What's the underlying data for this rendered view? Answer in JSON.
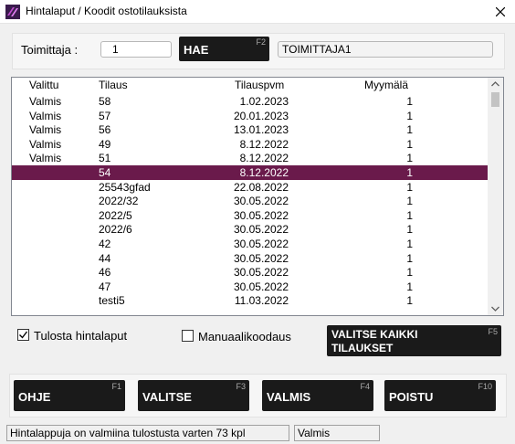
{
  "window": {
    "title": "Hintalaput / Koodit ostotilauksista",
    "icon": "app-logo-icon"
  },
  "supplier": {
    "label": "Toimittaja :",
    "value": "1",
    "search_button": "HAE",
    "search_key": "F2",
    "name": "TOIMITTAJA1"
  },
  "grid": {
    "headers": [
      "Valittu",
      "Tilaus",
      "Tilauspvm",
      "Myymälä"
    ],
    "rows": [
      {
        "status": "Valmis",
        "order": "58",
        "date": "1.02.2023",
        "store": "1"
      },
      {
        "status": "Valmis",
        "order": "57",
        "date": "20.01.2023",
        "store": "1"
      },
      {
        "status": "Valmis",
        "order": "56",
        "date": "13.01.2023",
        "store": "1"
      },
      {
        "status": "Valmis",
        "order": "49",
        "date": "8.12.2022",
        "store": "1"
      },
      {
        "status": "Valmis",
        "order": "51",
        "date": "8.12.2022",
        "store": "1"
      },
      {
        "status": "",
        "order": "54",
        "date": "8.12.2022",
        "store": "1",
        "selected": true
      },
      {
        "status": "",
        "order": "25543gfad",
        "date": "22.08.2022",
        "store": "1"
      },
      {
        "status": "",
        "order": "2022/32",
        "date": "30.05.2022",
        "store": "1"
      },
      {
        "status": "",
        "order": "2022/5",
        "date": "30.05.2022",
        "store": "1"
      },
      {
        "status": "",
        "order": "2022/6",
        "date": "30.05.2022",
        "store": "1"
      },
      {
        "status": "",
        "order": "42",
        "date": "30.05.2022",
        "store": "1"
      },
      {
        "status": "",
        "order": "44",
        "date": "30.05.2022",
        "store": "1"
      },
      {
        "status": "",
        "order": "46",
        "date": "30.05.2022",
        "store": "1"
      },
      {
        "status": "",
        "order": "47",
        "date": "30.05.2022",
        "store": "1"
      },
      {
        "status": "",
        "order": "testi5",
        "date": "11.03.2022",
        "store": "1"
      }
    ]
  },
  "options": {
    "print_labels": {
      "label": "Tulosta hintalaput",
      "checked": true
    },
    "manual_barcode": {
      "label": "Manuaalikoodaus",
      "checked": false
    },
    "select_all": {
      "label": "VALITSE KAIKKI TILAUKSET",
      "key": "F5"
    }
  },
  "buttons": [
    {
      "label": "OHJE",
      "key": "F1"
    },
    {
      "label": "VALITSE",
      "key": "F3"
    },
    {
      "label": "VALMIS",
      "key": "F4"
    },
    {
      "label": "POISTU",
      "key": "F10"
    }
  ],
  "status": {
    "message": "Hintalappuja on valmiina tulostusta varten 73  kpl",
    "state": "Valmis"
  },
  "colors": {
    "selected_row": "#6a1a4b",
    "button_bg": "#1a1a1a"
  }
}
